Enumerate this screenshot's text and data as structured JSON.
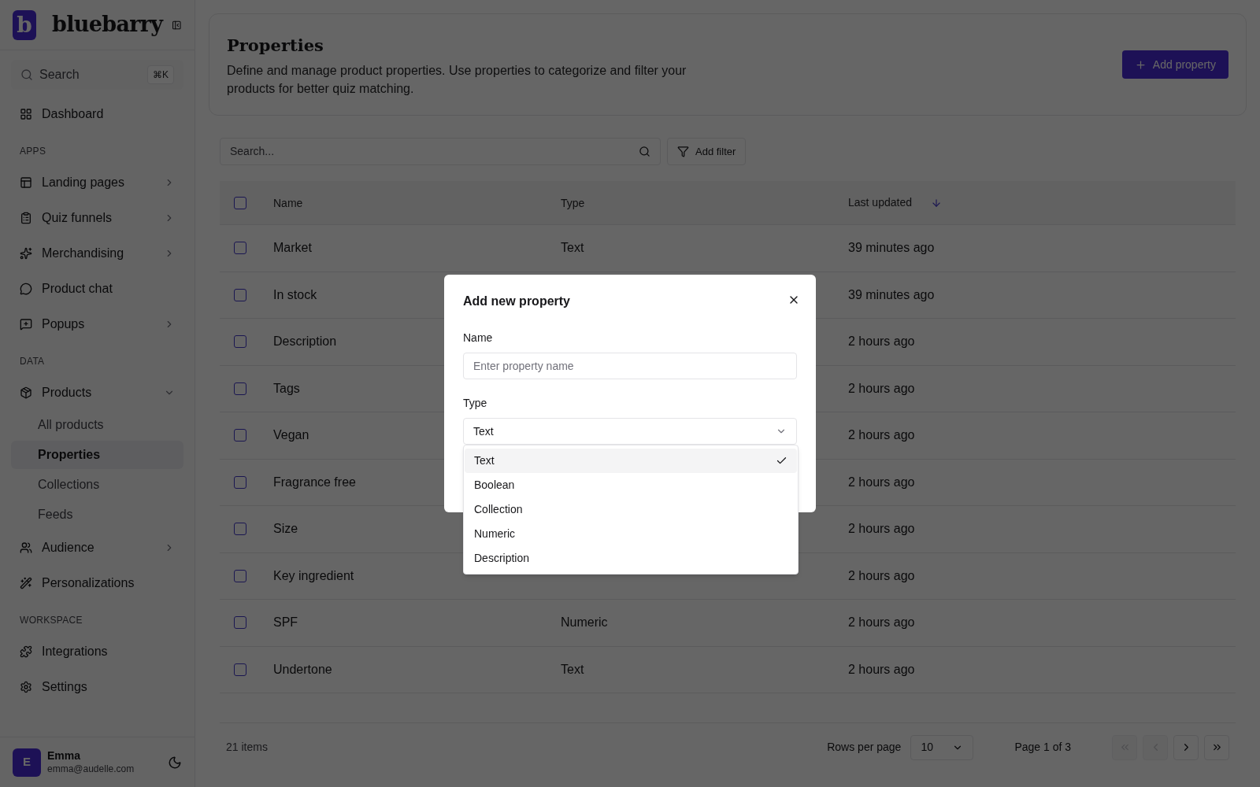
{
  "sidebar": {
    "brand": {
      "initial": "b",
      "name": "bluebarry"
    },
    "search": {
      "placeholder": "Search",
      "shortcut": "⌘K"
    },
    "sections": [
      {
        "items": [
          {
            "label": "Dashboard"
          }
        ]
      },
      {
        "heading": "APPS",
        "items": [
          {
            "label": "Landing pages",
            "expanded": false
          },
          {
            "label": "Quiz funnels",
            "expanded": false
          },
          {
            "label": "Merchandising",
            "expanded": false
          },
          {
            "label": "Product chat"
          },
          {
            "label": "Popups",
            "expanded": false
          }
        ]
      },
      {
        "heading": "DATA",
        "items": [
          {
            "label": "Products",
            "expanded": true,
            "children": [
              {
                "label": "All products",
                "selected": false
              },
              {
                "label": "Properties",
                "selected": true
              },
              {
                "label": "Collections",
                "selected": false
              },
              {
                "label": "Feeds",
                "selected": false
              }
            ]
          },
          {
            "label": "Audience",
            "expanded": false
          },
          {
            "label": "Personalizations"
          }
        ]
      },
      {
        "heading": "WORKSPACE",
        "items": [
          {
            "label": "Integrations"
          },
          {
            "label": "Settings"
          }
        ]
      }
    ],
    "user": {
      "initial": "E",
      "name": "Emma",
      "email": "emma@audelle.com"
    }
  },
  "header": {
    "title": "Properties",
    "description": "Define and manage product properties. Use properties to categorize and filter your products for better quiz matching.",
    "add_button": "Add property"
  },
  "toolbar": {
    "search_placeholder": "Search...",
    "filter_button": "Add filter"
  },
  "table": {
    "all_checked": false,
    "columns": [
      "Name",
      "Type",
      "Last updated"
    ],
    "rows": [
      {
        "name": "Market",
        "type": "Text",
        "updated": "39 minutes ago",
        "checked": false
      },
      {
        "name": "In stock",
        "updated": "39 minutes ago",
        "checked": false
      },
      {
        "name": "Description",
        "updated": "2 hours ago",
        "checked": false
      },
      {
        "name": "Tags",
        "updated": "2 hours ago",
        "checked": false
      },
      {
        "name": "Vegan",
        "updated": "2 hours ago",
        "checked": false
      },
      {
        "name": "Fragrance free",
        "updated": "2 hours ago",
        "checked": false
      },
      {
        "name": "Size",
        "updated": "2 hours ago",
        "checked": false
      },
      {
        "name": "Key ingredient",
        "updated": "2 hours ago",
        "checked": false
      },
      {
        "name": "SPF",
        "type": "Numeric",
        "updated": "2 hours ago",
        "checked": false
      },
      {
        "name": "Undertone",
        "type": "Text",
        "updated": "2 hours ago",
        "checked": false
      }
    ]
  },
  "pagination": {
    "count": "21 items",
    "rows_label": "Rows per page",
    "rows_value": "10",
    "page": "Page 1 of 3",
    "buttons": [
      {
        "kind": "first",
        "disabled": true
      },
      {
        "kind": "prev",
        "disabled": true
      },
      {
        "kind": "next",
        "disabled": false
      },
      {
        "kind": "last",
        "disabled": false
      }
    ]
  },
  "dialog": {
    "title": "Add new property",
    "name_label": "Name",
    "name_placeholder": "Enter property name",
    "type_label": "Type",
    "type_value": "Text",
    "options": [
      {
        "label": "Text",
        "selected": true
      },
      {
        "label": "Boolean",
        "selected": false
      },
      {
        "label": "Collection",
        "selected": false
      },
      {
        "label": "Numeric",
        "selected": false
      },
      {
        "label": "Description",
        "selected": false
      }
    ]
  }
}
